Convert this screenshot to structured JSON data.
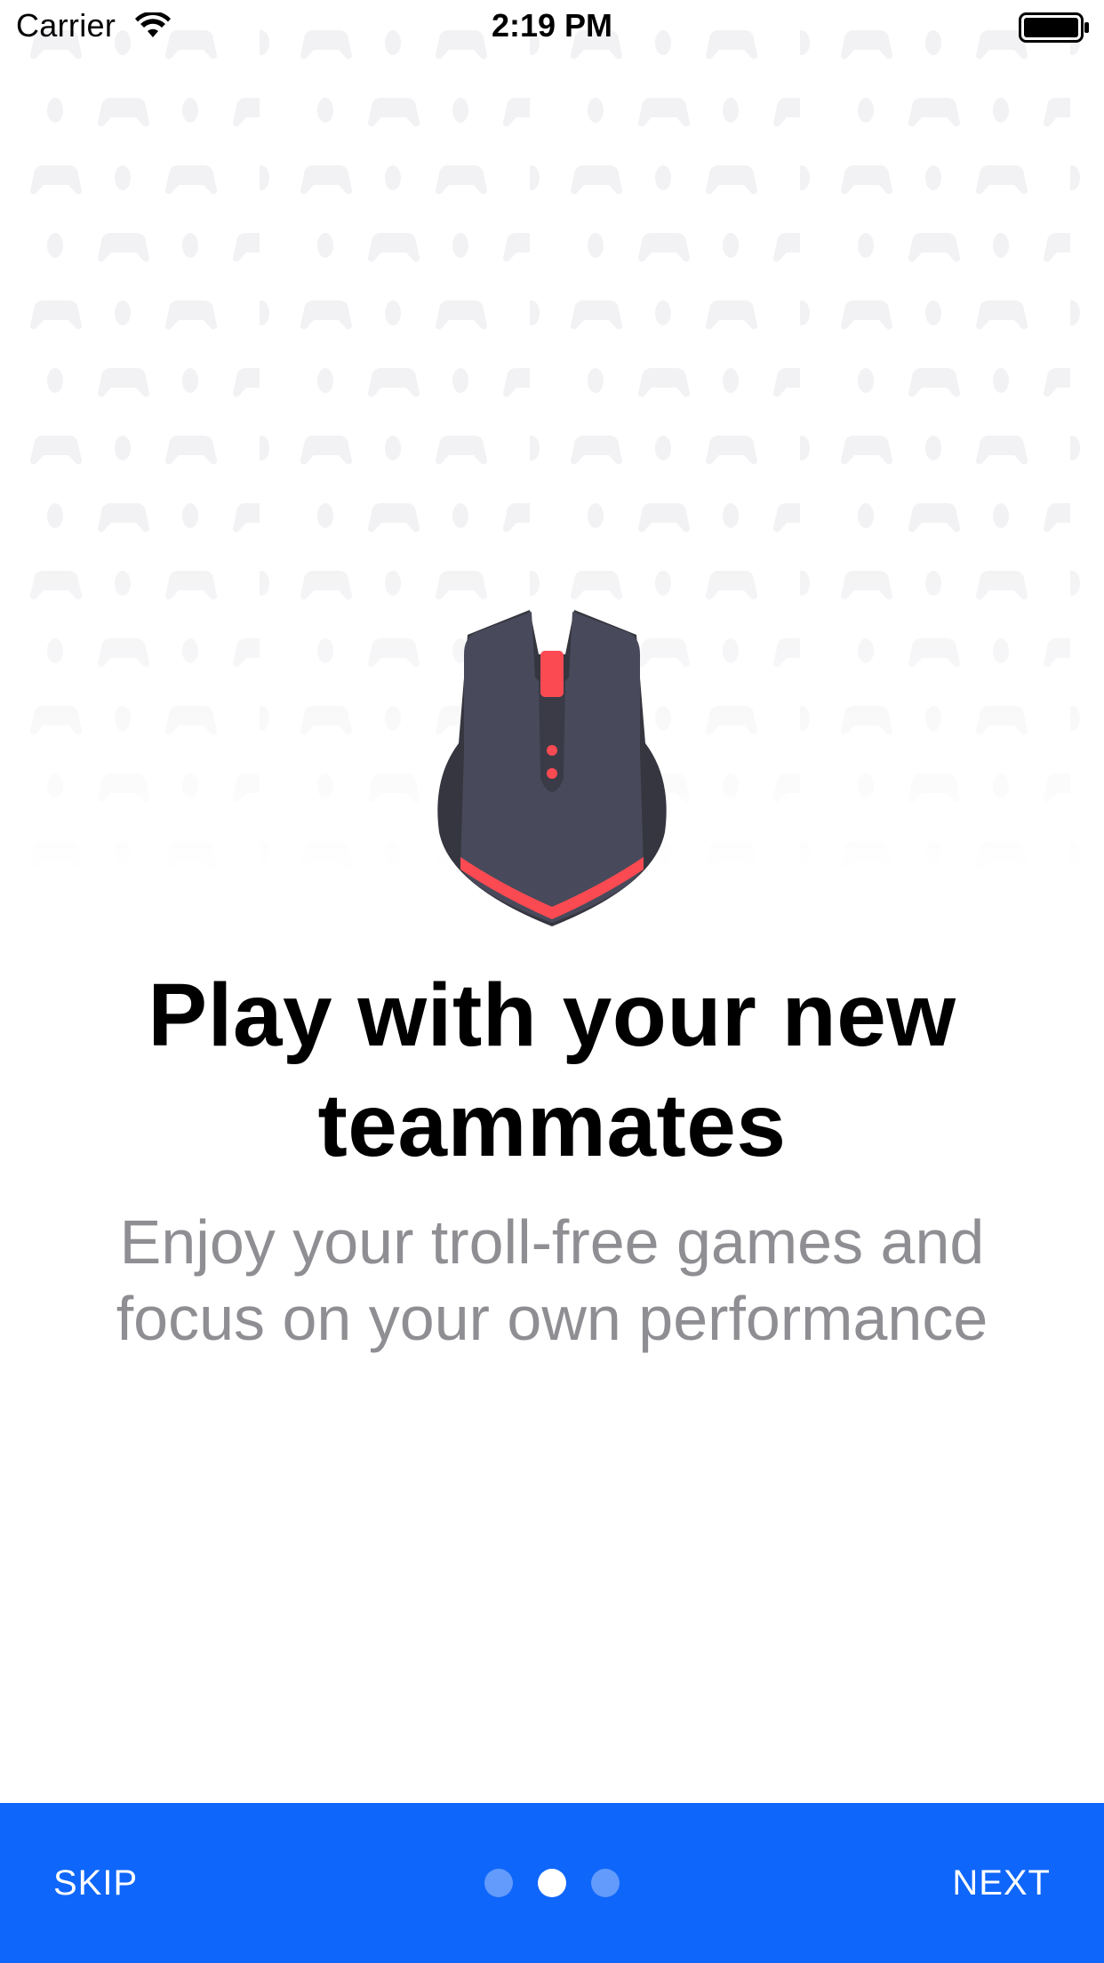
{
  "status_bar": {
    "carrier": "Carrier",
    "time": "2:19 PM",
    "wifi_icon": "wifi-icon",
    "battery_icon": "battery-icon"
  },
  "illustration": {
    "icon": "gaming-mouse-icon",
    "colors": {
      "body": "#484a5b",
      "dark": "#35363f",
      "accent": "#fb4a52"
    }
  },
  "onboarding": {
    "title": "Play with your new teammates",
    "subtitle": "Enjoy your troll-free games and focus on your own performance",
    "page_count": 3,
    "active_page": 2
  },
  "footer": {
    "skip_label": "SKIP",
    "next_label": "NEXT",
    "background": "#0f66fa"
  }
}
